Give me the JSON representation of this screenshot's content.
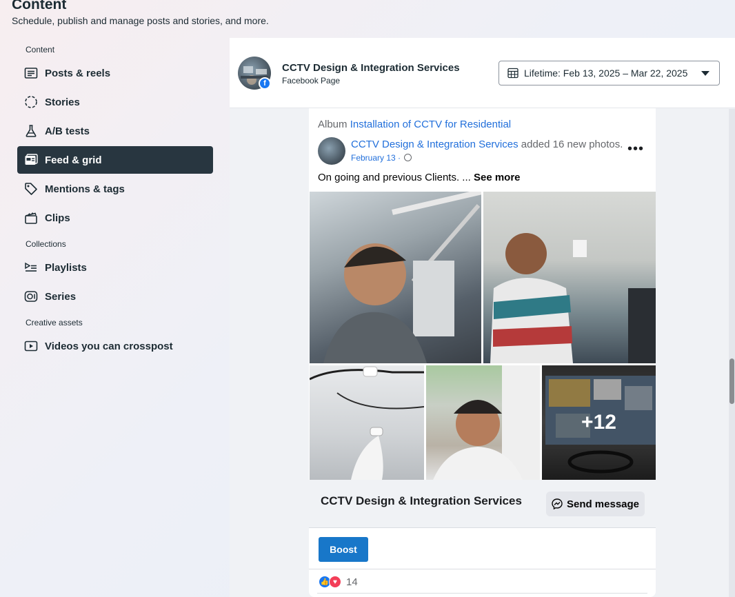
{
  "header": {
    "title": "Content",
    "subtitle": "Schedule, publish and manage posts and stories, and more."
  },
  "sidebar": {
    "sections": [
      {
        "label": "Content"
      },
      {
        "label": "Collections"
      },
      {
        "label": "Creative assets"
      }
    ],
    "items": [
      {
        "label": "Posts & reels",
        "icon": "posts-icon"
      },
      {
        "label": "Stories",
        "icon": "stories-icon"
      },
      {
        "label": "A/B tests",
        "icon": "flask-icon"
      },
      {
        "label": "Feed & grid",
        "icon": "feed-icon",
        "active": true
      },
      {
        "label": "Mentions & tags",
        "icon": "tag-icon"
      },
      {
        "label": "Clips",
        "icon": "clapper-icon"
      },
      {
        "label": "Playlists",
        "icon": "playlist-icon"
      },
      {
        "label": "Series",
        "icon": "series-icon"
      },
      {
        "label": "Videos you can crosspost",
        "icon": "video-icon"
      }
    ]
  },
  "panel": {
    "page_name": "CCTV Design & Integration Services",
    "page_type": "Facebook Page",
    "date_range": "Lifetime: Feb 13, 2025 – Mar 22, 2025"
  },
  "post": {
    "album_prefix": "Album",
    "album_name": "Installation of CCTV for Residential",
    "author": "CCTV Design & Integration Services",
    "action": "added 16 new photos.",
    "date": "February 13 ·",
    "text": "On going and previous Clients. ...",
    "see_more": "See more",
    "more_photos": "+12",
    "cta_name": "CCTV Design & Integration Services",
    "send_message": "Send message",
    "boost": "Boost",
    "reaction_count": "14"
  },
  "colors": {
    "accent": "#216fdb",
    "active_nav": "#283640",
    "boost": "#1877c9"
  }
}
